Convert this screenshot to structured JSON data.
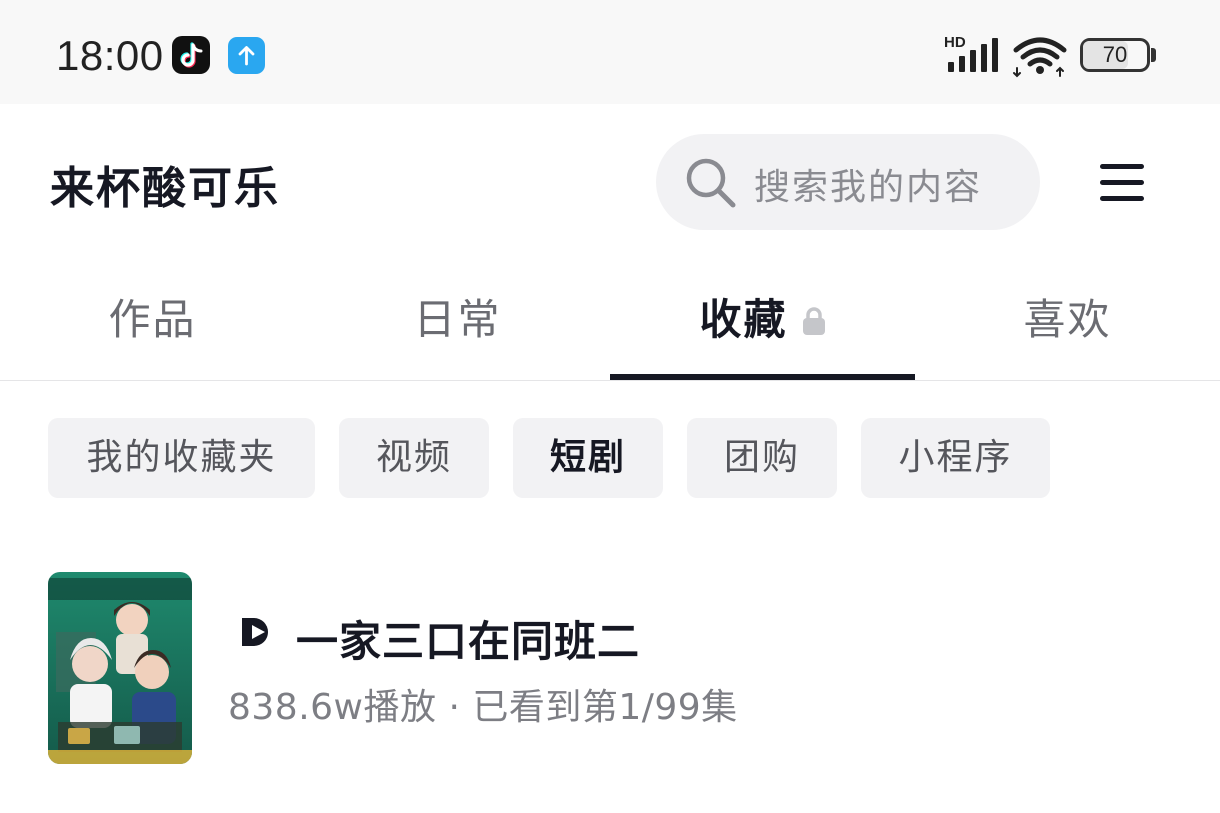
{
  "status_bar": {
    "time": "18:00",
    "network_label": "HD",
    "battery_percent": 70,
    "battery_text": "70",
    "icons": [
      "tiktok-icon",
      "upload-arrow-icon",
      "signal-icon",
      "wifi-icon",
      "battery-icon"
    ]
  },
  "header": {
    "profile_name": "来杯酸可乐",
    "search_placeholder": "搜索我的内容",
    "menu_icon": "hamburger-menu-icon"
  },
  "tabs": [
    {
      "label": "作品",
      "active": false
    },
    {
      "label": "日常",
      "active": false
    },
    {
      "label": "收藏",
      "active": true,
      "locked": true
    },
    {
      "label": "喜欢",
      "active": false
    }
  ],
  "filter_chips": [
    {
      "label": "我的收藏夹",
      "active": false
    },
    {
      "label": "视频",
      "active": false
    },
    {
      "label": "短剧",
      "active": true
    },
    {
      "label": "团购",
      "active": false
    },
    {
      "label": "小程序",
      "active": false
    }
  ],
  "drama_list": [
    {
      "title": "一家三口在同班二",
      "meta": "838.6w播放 · 已看到第1/99集",
      "badge_icon": "short-drama-play-icon"
    }
  ],
  "colors": {
    "text_primary": "#161823",
    "text_secondary": "#7d7e84",
    "chip_bg": "#f2f2f4",
    "status_bg": "#f8f8f8",
    "accent_upload": "#2aa7f0",
    "poster_green": "#1f8a6e"
  }
}
